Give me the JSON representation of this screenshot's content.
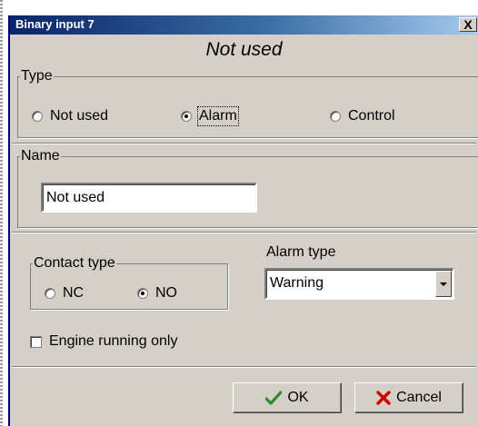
{
  "window": {
    "title": "Binary input 7",
    "close_label": "X"
  },
  "header": {
    "status_title": "Not used"
  },
  "type_group": {
    "legend": "Type",
    "options": [
      {
        "label": "Not used",
        "selected": false
      },
      {
        "label": "Alarm",
        "selected": true
      },
      {
        "label": "Control",
        "selected": false
      }
    ]
  },
  "name_group": {
    "legend": "Name",
    "value": "Not used"
  },
  "contact_group": {
    "legend": "Contact type",
    "options": [
      {
        "label": "NC",
        "selected": false
      },
      {
        "label": "NO",
        "selected": true
      }
    ]
  },
  "alarm_type": {
    "label": "Alarm type",
    "value": "Warning"
  },
  "engine_running": {
    "label": "Engine running only",
    "checked": false
  },
  "buttons": {
    "ok": {
      "label": "OK",
      "icon": "check-icon",
      "color": "#2e8b2e"
    },
    "cancel": {
      "label": "Cancel",
      "icon": "x-icon",
      "color": "#cc0000"
    }
  }
}
